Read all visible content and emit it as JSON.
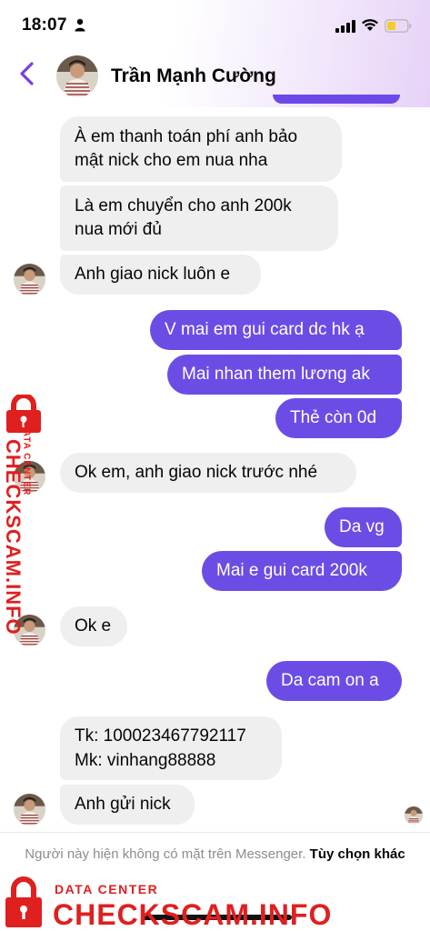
{
  "status_bar": {
    "time": "18:07"
  },
  "header": {
    "contact_name": "Trần Mạnh Cường"
  },
  "messages": [
    {
      "dir": "in",
      "text": "À em thanh toán phí anh bảo mật nick cho em nua nha"
    },
    {
      "dir": "in",
      "text": "Là em chuyển cho anh 200k nua mới đủ"
    },
    {
      "dir": "in",
      "text": "Anh giao nick luôn e"
    },
    {
      "dir": "out",
      "text": "V mai em gui card dc hk ạ"
    },
    {
      "dir": "out",
      "text": "Mai nhan them lương ak"
    },
    {
      "dir": "out",
      "text": "Thẻ còn 0d"
    },
    {
      "dir": "in",
      "text": "Ok em, anh giao nick trước nhé"
    },
    {
      "dir": "out",
      "text": "Da vg"
    },
    {
      "dir": "out",
      "text": "Mai e gui card 200k"
    },
    {
      "dir": "in",
      "text": "Ok e"
    },
    {
      "dir": "out",
      "text": "Da cam on a"
    },
    {
      "dir": "in",
      "text": "Tk: 100023467792117"
    },
    {
      "dir": "in",
      "text": "Mk: vinhang88888"
    },
    {
      "dir": "in",
      "text": "Anh gửi nick"
    }
  ],
  "footer": {
    "notice": "Người này hiện không có mặt trên Messenger.",
    "options_link": "Tùy chọn khác"
  },
  "watermark": {
    "small_text": "DATA CENTER",
    "brand": "CHECKSCAM.INFO"
  },
  "colors": {
    "outgoing_bubble": "#6b4de6",
    "incoming_bubble": "#efefef",
    "accent": "#7a3fe0",
    "watermark": "#e01f1f"
  }
}
